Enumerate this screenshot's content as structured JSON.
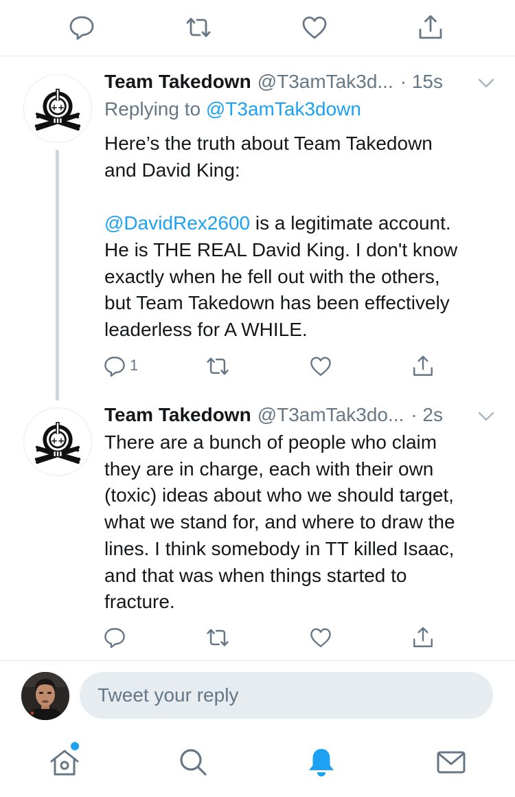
{
  "colors": {
    "accent": "#1da1f2",
    "secondary_text": "#657786",
    "primary_text": "#14171a",
    "divider": "#e1e8ed",
    "input_bg": "#e6ecf0"
  },
  "top_actions": {
    "icons": [
      "reply-icon",
      "retweet-icon",
      "like-icon",
      "share-icon"
    ]
  },
  "tweets": [
    {
      "author_name": "Team Takedown",
      "handle": "@T3amTak3d...",
      "time": "· 15s",
      "reply_prefix": "Replying to ",
      "reply_handle": "@T3amTak3down",
      "text_line1": "Here’s the truth about Team Takedown",
      "text_line2": "and David King:",
      "mention": "@DavidRex2600",
      "text_rest_1": " is a legitimate account.",
      "text_rest_2": "He is THE REAL David King. I don't know",
      "text_rest_3": "exactly when he fell out with the others,",
      "text_rest_4": "but Team Takedown has been effectively",
      "text_rest_5": "leaderless for A WHILE.",
      "reply_count": "1"
    },
    {
      "author_name": "Team Takedown",
      "handle": "@T3amTak3do...",
      "time": "· 2s",
      "lines": [
        "There are a bunch of people who claim",
        "they are in charge, each with their own",
        "(toxic) ideas about who we should target,",
        "what we stand for, and where to draw the",
        "lines. I think somebody in TT killed Isaac,",
        "and that was when things started to",
        "fracture."
      ]
    }
  ],
  "composer": {
    "placeholder": "Tweet your reply"
  },
  "bottom_nav": {
    "icons": [
      "home-icon",
      "search-icon",
      "notifications-icon",
      "messages-icon"
    ],
    "active": "notifications-icon"
  }
}
